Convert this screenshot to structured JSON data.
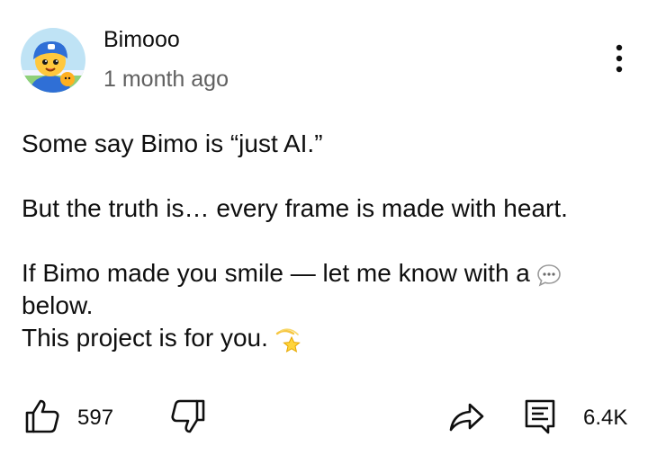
{
  "comment": {
    "author": "Bimooo",
    "timestamp": "1 month ago",
    "lines": [
      "Some say Bimo is “just AI.”",
      "But the truth is… every frame is made with heart.",
      "If Bimo made you smile — let me know with a",
      "below.",
      "This project is for you."
    ],
    "emojis": {
      "line3": "speech-bubble-emoji",
      "line5": "dizzy-star-emoji"
    }
  },
  "actions": {
    "like_count": "597",
    "reply_count": "6.4K"
  },
  "icons": {
    "like": "thumbs-up-icon",
    "dislike": "thumbs-down-icon",
    "share": "share-arrow-icon",
    "comments": "comments-icon",
    "more": "more-vertical-icon"
  },
  "colors": {
    "text": "#0f0f0f",
    "secondary_text": "#606060",
    "background": "#ffffff"
  }
}
